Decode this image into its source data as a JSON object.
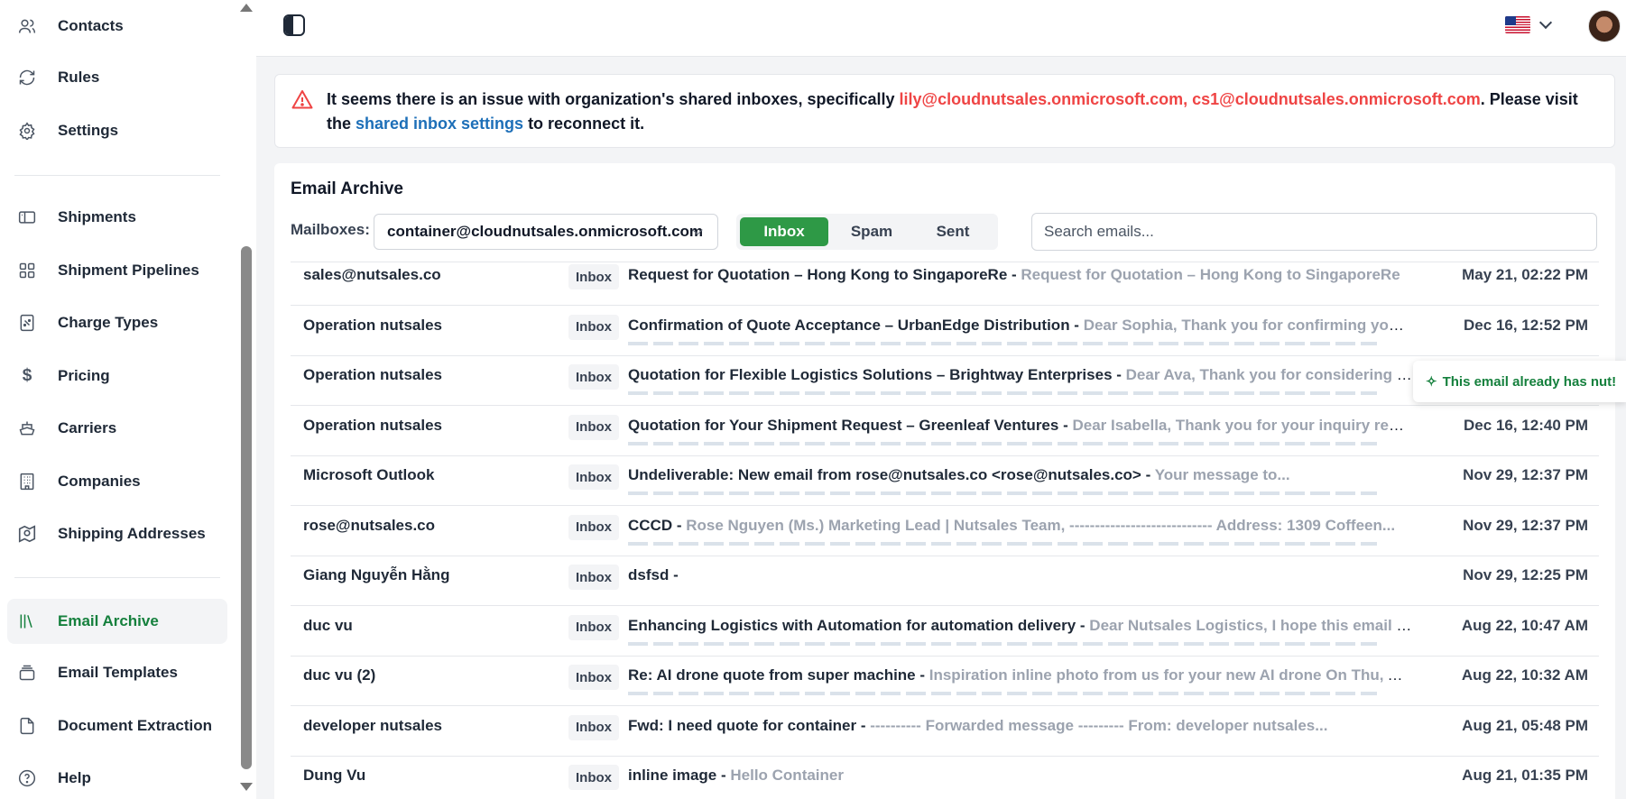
{
  "sidebar": {
    "items": [
      {
        "label": "Contacts",
        "icon": "users-icon"
      },
      {
        "label": "Rules",
        "icon": "refresh-icon"
      },
      {
        "label": "Settings",
        "icon": "gear-icon"
      },
      {
        "label": "Shipments",
        "icon": "box-icon"
      },
      {
        "label": "Shipment Pipelines",
        "icon": "grid-icon"
      },
      {
        "label": "Charge Types",
        "icon": "receipt-icon"
      },
      {
        "label": "Pricing",
        "icon": "dollar-icon"
      },
      {
        "label": "Carriers",
        "icon": "ship-icon"
      },
      {
        "label": "Companies",
        "icon": "building-icon"
      },
      {
        "label": "Shipping Addresses",
        "icon": "map-pin-icon"
      },
      {
        "label": "Email Archive",
        "icon": "library-icon",
        "active": true
      },
      {
        "label": "Email Templates",
        "icon": "layers-icon"
      },
      {
        "label": "Document Extraction",
        "icon": "file-icon"
      },
      {
        "label": "Help",
        "icon": "help-icon"
      }
    ]
  },
  "alert": {
    "prefix": "It seems there is an issue with organization's shared inboxes, specifically ",
    "emails": "lily@cloudnutsales.onmicrosoft.com, cs1@cloudnutsales.onmicrosoft.com",
    "middle": ". Please visit the ",
    "link": "shared inbox settings",
    "suffix": " to reconnect it."
  },
  "archive": {
    "title": "Email Archive",
    "mailboxes_label": "Mailboxes:",
    "mailbox_value": "container@cloudnutsales.onmicrosoft.com",
    "tabs": [
      "Inbox",
      "Spam",
      "Sent"
    ],
    "active_tab": "Inbox",
    "search_placeholder": "Search emails...",
    "rows": [
      {
        "sender": "sales@nutsales.co",
        "badge": "Inbox",
        "subject": "Request for Quotation – Hong Kong to SingaporeRe",
        "preview": "Request for Quotation – Hong Kong to SingaporeRe",
        "date": "May 21, 02:22 PM"
      },
      {
        "sender": "Operation nutsales",
        "badge": "Inbox",
        "subject": "Confirmation of Quote Acceptance – UrbanEdge Distribution",
        "preview": "Dear Sophia, Thank you for confirming your...",
        "date": "Dec 16, 12:52 PM"
      },
      {
        "sender": "Operation nutsales",
        "badge": "Inbox",
        "subject": "Quotation for Flexible Logistics Solutions – Brightway Enterprises",
        "preview": "Dear Ava, Thank you for considering Global...",
        "date": ""
      },
      {
        "sender": "Operation nutsales",
        "badge": "Inbox",
        "subject": "Quotation for Your Shipment Request – Greenleaf Ventures",
        "preview": "Dear Isabella, Thank you for your inquiry regarding...",
        "date": "Dec 16, 12:40 PM"
      },
      {
        "sender": "Microsoft Outlook",
        "badge": "Inbox",
        "subject": "Undeliverable: New email from rose@nutsales.co <rose@nutsales.co>",
        "preview": "Your message to...",
        "date": "Nov 29, 12:37 PM"
      },
      {
        "sender": "rose@nutsales.co",
        "badge": "Inbox",
        "subject": "CCCD",
        "preview": "Rose Nguyen (Ms.) Marketing Lead | Nutsales Team, ---------------------------- Address: 1309 Coffeen...",
        "date": "Nov 29, 12:37 PM"
      },
      {
        "sender": "Giang Nguyễn Hằng",
        "badge": "Inbox",
        "subject": "dsfsd",
        "preview": "",
        "date": "Nov 29, 12:25 PM"
      },
      {
        "sender": "duc vu",
        "badge": "Inbox",
        "subject": "Enhancing Logistics with Automation for automation delivery",
        "preview": "Dear Nutsales Logistics, I hope this email finds...",
        "date": "Aug 22, 10:47 AM"
      },
      {
        "sender": "duc vu (2)",
        "badge": "Inbox",
        "subject": "Re: AI drone quote from super machine",
        "preview": "Inspiration inline photo from us for your new AI drone On Thu, Aug 22,...",
        "date": "Aug 22, 10:32 AM"
      },
      {
        "sender": "developer nutsales",
        "badge": "Inbox",
        "subject": "Fwd: I need quote for container",
        "preview": "---------- Forwarded message --------- From: developer nutsales...",
        "date": "Aug 21, 05:48 PM"
      },
      {
        "sender": "Dung Vu",
        "badge": "Inbox",
        "subject": "inline image",
        "preview": "Hello Container",
        "date": "Aug 21, 01:35 PM"
      }
    ]
  },
  "toast": {
    "text": "This email already has nut!"
  },
  "colors": {
    "accent": "#2e9946",
    "alert_red": "#ef4444",
    "link_blue": "#1d6fb8"
  }
}
